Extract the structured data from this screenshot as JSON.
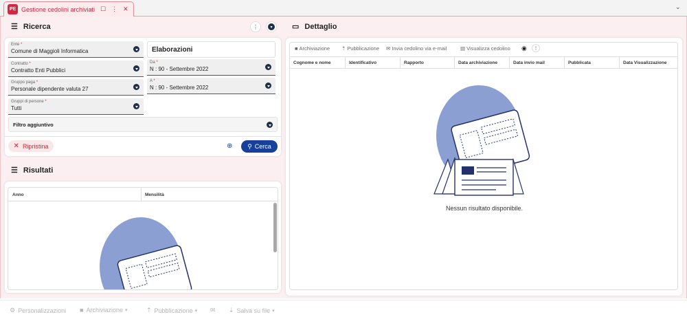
{
  "app": {
    "logo_text": "PE",
    "accent": "#d6253f"
  },
  "tab": {
    "title": "Gestione cedolini archiviati"
  },
  "ricerca": {
    "title": "Ricerca",
    "fields": {
      "ente": {
        "label": "Ente",
        "value": "Comune di Maggioli Informatica"
      },
      "contratto": {
        "label": "Contratto",
        "value": "Contratto Enti Pubblici"
      },
      "gruppo_paga": {
        "label": "Gruppo paga",
        "value": "Personale dipendente valuta 27"
      },
      "gruppi_persone": {
        "label": "Gruppi di persone",
        "value": "Tutti"
      },
      "elaborazioni_title": "Elaborazioni",
      "da": {
        "label": "Da",
        "value": "N : 90 - Settembre 2022"
      },
      "a": {
        "label": "A",
        "value": "N : 90 - Settembre 2022"
      }
    },
    "filtro_aggiuntivo": "Filtro aggiuntivo",
    "reset_label": "Ripristina",
    "search_label": "Cerca",
    "required_mark": "*"
  },
  "risultati": {
    "title": "Risultati",
    "columns": [
      "Anno",
      "Mensilità"
    ]
  },
  "dettaglio": {
    "title": "Dettaglio",
    "toolbar": [
      "Archiviazione",
      "Pubblicazione",
      "Invia cedolino via e-mail",
      "Visualizza cedolino"
    ],
    "columns": [
      "Cognome e nome",
      "Identificativo",
      "Rapporto",
      "Data archiviazione",
      "Data invio mail",
      "Pubblicata",
      "Data Visualizzazione"
    ],
    "empty_message": "Nessun risultato disponibile."
  },
  "footer": {
    "buttons": [
      "Personalizzazioni",
      "Archiviazione",
      "Pubblicazione",
      "Salva su file"
    ]
  },
  "colors": {
    "primary": "#16409a",
    "illustration": "#8b9fd3",
    "danger": "#c62b3a"
  }
}
